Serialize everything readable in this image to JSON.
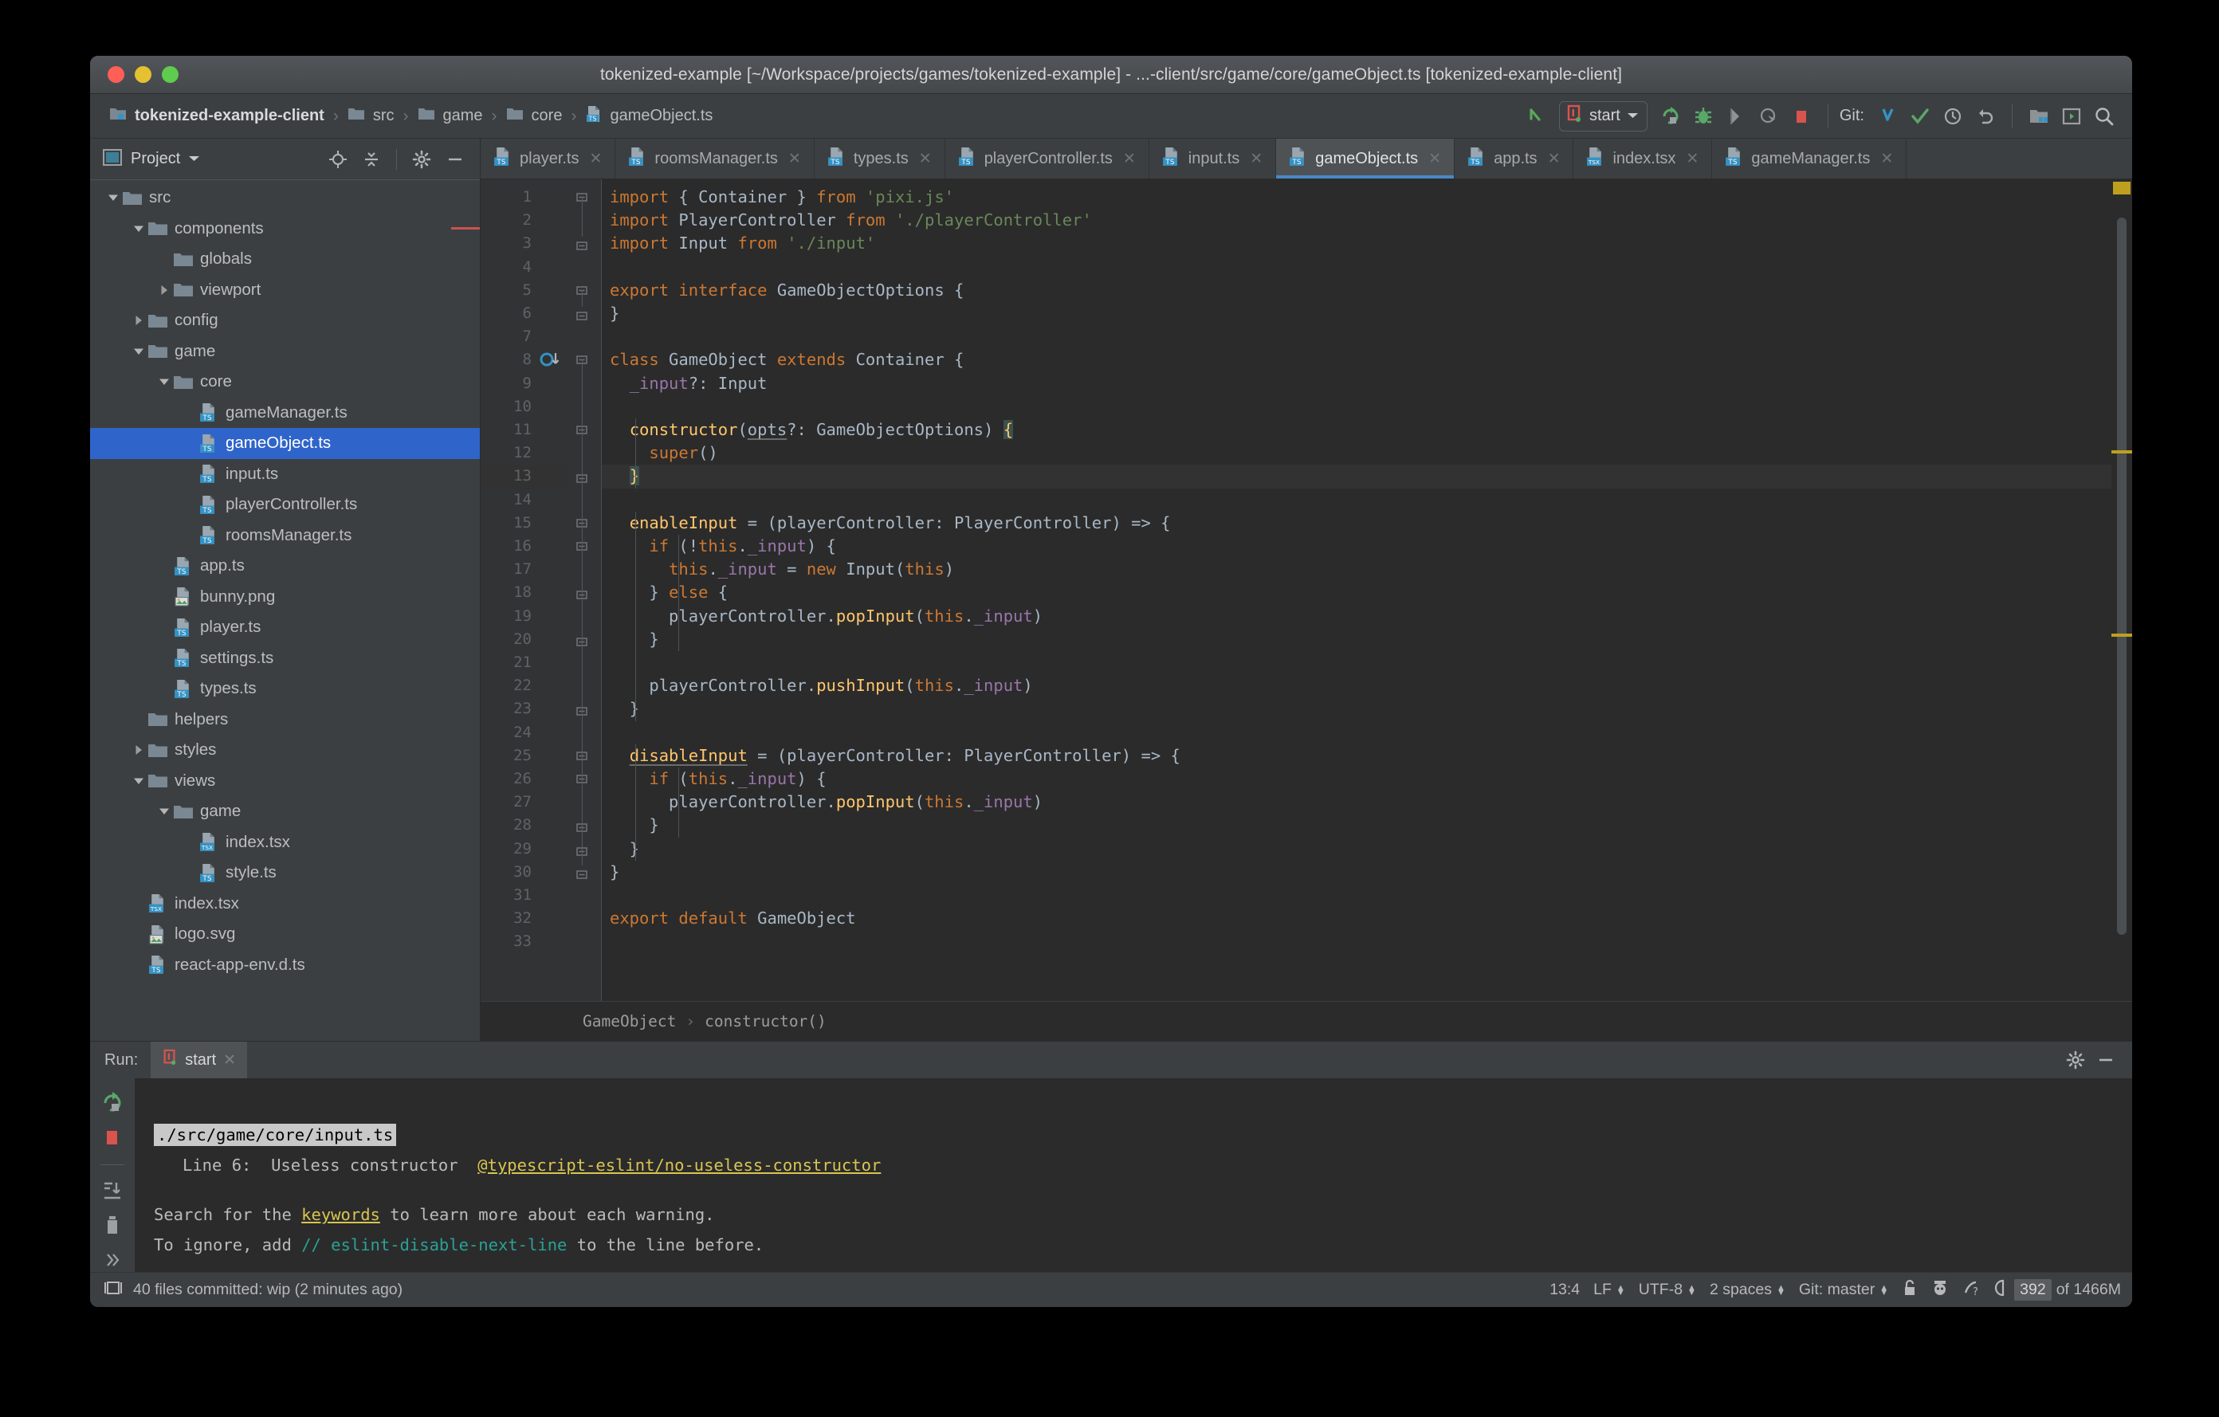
{
  "window": {
    "title": "tokenized-example [~/Workspace/projects/games/tokenized-example] - ...-client/src/game/core/gameObject.ts [tokenized-example-client]"
  },
  "navbar": {
    "crumbs": [
      {
        "label": "tokenized-example-client",
        "icon": "project-module-icon",
        "bold": true
      },
      {
        "label": "src",
        "icon": "folder-icon",
        "bold": false
      },
      {
        "label": "game",
        "icon": "folder-icon",
        "bold": false
      },
      {
        "label": "core",
        "icon": "folder-icon",
        "bold": false
      },
      {
        "label": "gameObject.ts",
        "icon": "ts-file-icon",
        "bold": false
      }
    ],
    "run_config": "start",
    "git_label": "Git:",
    "icons": [
      "back-arrow-icon",
      "run-icon",
      "debug-icon",
      "run-coverage-icon",
      "profile-icon",
      "stop-icon",
      "git-update-icon",
      "git-commit-icon",
      "git-history-icon",
      "git-rollback-icon",
      "project-structure-icon",
      "terminal-icon",
      "search-everywhere-icon"
    ]
  },
  "sidebar": {
    "title": "Project",
    "header_icons": [
      "locate-icon",
      "collapse-all-icon",
      "gear-icon",
      "minimize-icon"
    ],
    "tree": [
      {
        "label": "src",
        "depth": 1,
        "state": "expanded",
        "icon": "folder-icon"
      },
      {
        "label": "components",
        "depth": 2,
        "state": "expanded",
        "icon": "folder-icon",
        "marker": true
      },
      {
        "label": "globals",
        "depth": 3,
        "state": "leaf",
        "icon": "folder-icon"
      },
      {
        "label": "viewport",
        "depth": 3,
        "state": "collapsed",
        "icon": "folder-icon"
      },
      {
        "label": "config",
        "depth": 2,
        "state": "collapsed",
        "icon": "folder-icon"
      },
      {
        "label": "game",
        "depth": 2,
        "state": "expanded",
        "icon": "folder-icon"
      },
      {
        "label": "core",
        "depth": 3,
        "state": "expanded",
        "icon": "folder-icon"
      },
      {
        "label": "gameManager.ts",
        "depth": 4,
        "state": "leaf",
        "icon": "ts-file-icon"
      },
      {
        "label": "gameObject.ts",
        "depth": 4,
        "state": "leaf",
        "icon": "ts-file-icon",
        "selected": true
      },
      {
        "label": "input.ts",
        "depth": 4,
        "state": "leaf",
        "icon": "ts-file-icon"
      },
      {
        "label": "playerController.ts",
        "depth": 4,
        "state": "leaf",
        "icon": "ts-file-icon"
      },
      {
        "label": "roomsManager.ts",
        "depth": 4,
        "state": "leaf",
        "icon": "ts-file-icon"
      },
      {
        "label": "app.ts",
        "depth": 3,
        "state": "leaf",
        "icon": "ts-file-icon"
      },
      {
        "label": "bunny.png",
        "depth": 3,
        "state": "leaf",
        "icon": "image-file-icon"
      },
      {
        "label": "player.ts",
        "depth": 3,
        "state": "leaf",
        "icon": "ts-file-icon"
      },
      {
        "label": "settings.ts",
        "depth": 3,
        "state": "leaf",
        "icon": "ts-file-icon"
      },
      {
        "label": "types.ts",
        "depth": 3,
        "state": "leaf",
        "icon": "ts-file-icon"
      },
      {
        "label": "helpers",
        "depth": 2,
        "state": "leaf",
        "icon": "folder-icon"
      },
      {
        "label": "styles",
        "depth": 2,
        "state": "collapsed",
        "icon": "folder-icon"
      },
      {
        "label": "views",
        "depth": 2,
        "state": "expanded",
        "icon": "folder-icon"
      },
      {
        "label": "game",
        "depth": 3,
        "state": "expanded",
        "icon": "folder-icon"
      },
      {
        "label": "index.tsx",
        "depth": 4,
        "state": "leaf",
        "icon": "tsx-file-icon"
      },
      {
        "label": "style.ts",
        "depth": 4,
        "state": "leaf",
        "icon": "ts-file-icon"
      },
      {
        "label": "index.tsx",
        "depth": 2,
        "state": "leaf",
        "icon": "tsx-file-icon"
      },
      {
        "label": "logo.svg",
        "depth": 2,
        "state": "leaf",
        "icon": "image-file-icon"
      },
      {
        "label": "react-app-env.d.ts",
        "depth": 2,
        "state": "leaf",
        "icon": "ts-file-icon"
      }
    ]
  },
  "tabs": [
    {
      "label": "player.ts",
      "icon": "ts-file-icon",
      "active": false
    },
    {
      "label": "roomsManager.ts",
      "icon": "ts-file-icon",
      "active": false
    },
    {
      "label": "types.ts",
      "icon": "ts-file-icon",
      "active": false
    },
    {
      "label": "playerController.ts",
      "icon": "ts-file-icon",
      "active": false
    },
    {
      "label": "input.ts",
      "icon": "ts-file-icon",
      "active": false
    },
    {
      "label": "gameObject.ts",
      "icon": "ts-file-icon",
      "active": true
    },
    {
      "label": "app.ts",
      "icon": "ts-file-icon",
      "active": false
    },
    {
      "label": "index.tsx",
      "icon": "tsx-file-icon",
      "active": false
    },
    {
      "label": "gameManager.ts",
      "icon": "ts-file-icon",
      "active": false
    }
  ],
  "editor": {
    "file": "gameObject.ts",
    "total_lines": 33,
    "caret_line": 13,
    "lines": [
      {
        "n": 1,
        "html": "<span class='k'>import</span> { Container } <span class='k'>from</span> <span class='s'>'pixi.js'</span>",
        "fold": "start"
      },
      {
        "n": 2,
        "html": "<span class='k'>import</span> PlayerController <span class='k'>from</span> <span class='s'>'./playerController'</span>"
      },
      {
        "n": 3,
        "html": "<span class='k'>import</span> Input <span class='k'>from</span> <span class='s'>'./input'</span>",
        "fold": "end"
      },
      {
        "n": 4,
        "html": ""
      },
      {
        "n": 5,
        "html": "<span class='k'>export</span> <span class='k'>interface</span> GameObjectOptions {",
        "fold": "start"
      },
      {
        "n": 6,
        "html": "}",
        "fold": "end"
      },
      {
        "n": 7,
        "html": ""
      },
      {
        "n": 8,
        "html": "<span class='k'>class</span> GameObject <span class='k'>extends</span> Container {",
        "fold": "start",
        "gutter_icon": "implementing-method-icon"
      },
      {
        "n": 9,
        "html": "  <span class='fld'>_input</span>?: Input"
      },
      {
        "n": 10,
        "html": ""
      },
      {
        "n": 11,
        "html": "  <span class='fn'>constructor</span>(<span class='warnu'>opts</span>?: GameObjectOptions) <span class='bracehl'>{</span>",
        "fold": "start"
      },
      {
        "n": 12,
        "html": "    <span class='k'>super</span>()"
      },
      {
        "n": 13,
        "html": "  <span class='bracehl'>}</span>",
        "fold": "end"
      },
      {
        "n": 14,
        "html": ""
      },
      {
        "n": 15,
        "html": "  <span class='fn'>enableInput</span> = (playerController: PlayerController) =&gt; {",
        "fold": "start"
      },
      {
        "n": 16,
        "html": "    <span class='k'>if</span> (!<span class='k'>this</span>.<span class='fld'>_input</span>) {",
        "fold": "start"
      },
      {
        "n": 17,
        "html": "      <span class='k'>this</span>.<span class='fld'>_input</span> = <span class='k'>new</span> Input(<span class='k'>this</span>)"
      },
      {
        "n": 18,
        "html": "    } <span class='k'>else</span> {",
        "fold": "end"
      },
      {
        "n": 19,
        "html": "      playerController.<span class='fn'>popInput</span>(<span class='k'>this</span>.<span class='fld'>_input</span>)"
      },
      {
        "n": 20,
        "html": "    }",
        "fold": "end"
      },
      {
        "n": 21,
        "html": ""
      },
      {
        "n": 22,
        "html": "    playerController.<span class='fn'>pushInput</span>(<span class='k'>this</span>.<span class='fld'>_input</span>)"
      },
      {
        "n": 23,
        "html": "  }",
        "fold": "end"
      },
      {
        "n": 24,
        "html": ""
      },
      {
        "n": 25,
        "html": "  <span class='fn warnu'>disableInput</span> = (playerController: PlayerController) =&gt; {",
        "fold": "start"
      },
      {
        "n": 26,
        "html": "    <span class='k'>if</span> (<span class='k'>this</span>.<span class='fld'>_input</span>) {",
        "fold": "start"
      },
      {
        "n": 27,
        "html": "      playerController.<span class='fn'>popInput</span>(<span class='k'>this</span>.<span class='fld'>_input</span>)"
      },
      {
        "n": 28,
        "html": "    }",
        "fold": "end"
      },
      {
        "n": 29,
        "html": "  }",
        "fold": "end"
      },
      {
        "n": 30,
        "html": "}",
        "fold": "end"
      },
      {
        "n": 31,
        "html": ""
      },
      {
        "n": 32,
        "html": "<span class='k'>export</span> <span class='k'>default</span> GameObject"
      },
      {
        "n": 33,
        "html": ""
      }
    ],
    "breadcrumb": [
      "GameObject",
      "constructor()"
    ],
    "breadcrumb_separator": "›"
  },
  "run_panel": {
    "label": "Run:",
    "tab": "start",
    "toolbar_icons": [
      "rerun-icon",
      "stop-icon",
      "scroll-to-end-icon",
      "trash-icon",
      "more-icon"
    ],
    "header_icons": [
      "gear-icon",
      "minimize-icon"
    ],
    "console": {
      "file_path": "./src/game/core/input.ts",
      "warning_line": "Line 6:",
      "warning_message": "Useless constructor",
      "warning_rule": "@typescript-eslint/no-useless-constructor",
      "hint1_prefix": "Search for the ",
      "hint1_link": "keywords",
      "hint1_suffix": " to learn more about each warning.",
      "hint2_prefix": "To ignore, add ",
      "hint2_code": "// eslint-disable-next-line",
      "hint2_suffix": " to the line before."
    }
  },
  "status_bar": {
    "vcs_message": "40 files committed: wip (2 minutes ago)",
    "caret_position": "13:4",
    "line_separator": "LF",
    "encoding": "UTF-8",
    "indent": "2 spaces",
    "branch": "Git: master",
    "memory_used": "392",
    "memory_total": "of 1466M",
    "icons": [
      "vcs-icon",
      "lock-icon",
      "inspector-icon",
      "event-log-icon",
      "memory-icon"
    ]
  },
  "colors": {
    "accent_blue": "#2f65ca",
    "tab_underline": "#4a88c7",
    "warning_yellow": "#bfa01e",
    "keyword_orange": "#cc7832",
    "string_green": "#6a8759",
    "function_yellow": "#ffc66d",
    "field_purple": "#9876aa",
    "editor_bg": "#2b2b2b",
    "chrome_bg": "#3c3f41"
  }
}
